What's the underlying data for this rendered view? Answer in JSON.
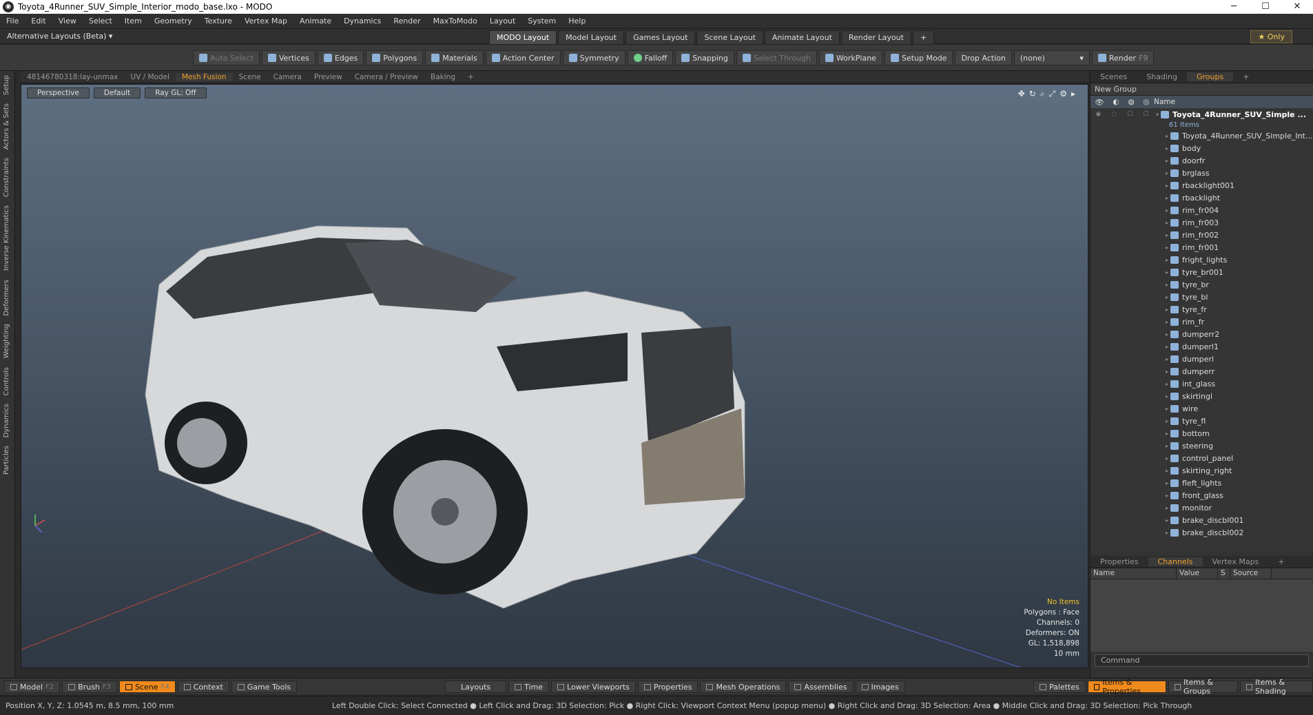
{
  "window": {
    "title": "Toyota_4Runner_SUV_Simple_Interior_modo_base.lxo - MODO",
    "minimize": "─",
    "maximize": "☐",
    "close": "✕"
  },
  "menu": [
    "File",
    "Edit",
    "View",
    "Select",
    "Item",
    "Geometry",
    "Texture",
    "Vertex Map",
    "Animate",
    "Dynamics",
    "Render",
    "MaxToModo",
    "Layout",
    "System",
    "Help"
  ],
  "layout": {
    "alt_layouts": "Alternative Layouts (Beta) ▾",
    "tabs": [
      "MODO Layout",
      "Model Layout",
      "Games Layout",
      "Scene Layout",
      "Animate Layout",
      "Render Layout"
    ],
    "add": "+",
    "only": "★ Only"
  },
  "toolbar": {
    "auto_select": "Auto Select",
    "vertices": "Vertices",
    "edges": "Edges",
    "polygons": "Polygons",
    "materials": "Materials",
    "action_center": "Action Center",
    "symmetry": "Symmetry",
    "falloff": "Falloff",
    "snapping": "Snapping",
    "select_through": "Select Through",
    "workplane": "WorkPlane",
    "setup_mode": "Setup Mode",
    "drop_action": "Drop Action",
    "drop_value": "(none)",
    "render": "Render",
    "render_key": "F9"
  },
  "left_tabs": [
    "Setup",
    "Actors & Sets",
    "Constraints",
    "Inverse Kinematics",
    "Deformers",
    "Weighting",
    "Controls",
    "Dynamics",
    "Particles"
  ],
  "viewport_tabs": [
    "48146780318:lay-unmax",
    "UV / Model",
    "Mesh Fusion",
    "Scene",
    "Camera",
    "Preview",
    "Camera / Preview",
    "Baking",
    "+"
  ],
  "viewport": {
    "view": "Perspective",
    "shading": "Default",
    "raygl": "Ray GL: Off",
    "stats": {
      "no_items": "No Items",
      "polygons": "Polygons : Face",
      "channels": "Channels: 0",
      "deformers": "Deformers: ON",
      "gl": "GL: 1,518,898",
      "grid": "10 mm"
    }
  },
  "right_panel": {
    "tabs": [
      "Scenes",
      "Shading",
      "Groups",
      "+"
    ],
    "new_group": "New Group",
    "name_header": "Name",
    "root": "Toyota_4Runner_SUV_Simple ...",
    "root_count": "61 Items",
    "items": [
      "Toyota_4Runner_SUV_Simple_Int...",
      "body",
      "doorfr",
      "brglass",
      "rbacklight001",
      "rbacklight",
      "rim_fr004",
      "rim_fr003",
      "rim_fr002",
      "rim_fr001",
      "fright_lights",
      "tyre_br001",
      "tyre_br",
      "tyre_bl",
      "tyre_fr",
      "rim_fr",
      "dumperr2",
      "dumperl1",
      "dumperl",
      "dumperr",
      "int_glass",
      "skirtingl",
      "wire",
      "tyre_fl",
      "bottom",
      "steering",
      "control_panel",
      "skirting_right",
      "fleft_lights",
      "front_glass",
      "monitor",
      "brake_discbl001",
      "brake_discbl002"
    ],
    "channel_tabs": [
      "Properties",
      "Channels",
      "Vertex Maps",
      "+"
    ],
    "channel_cols": [
      "Name",
      "Value",
      "S",
      "Source"
    ],
    "command_placeholder": "Command"
  },
  "bottom": {
    "model": "Model",
    "model_key": "F2",
    "brush": "Brush",
    "brush_key": "F3",
    "scene": "Scene",
    "scene_key": "F4",
    "context": "Context",
    "game_tools": "Game Tools",
    "layouts": "Layouts",
    "time": "Time",
    "lower_viewports": "Lower Viewports",
    "properties": "Properties",
    "mesh_operations": "Mesh Operations",
    "assemblies": "Assemblies",
    "images": "Images",
    "palettes": "Palettes",
    "items_properties": "Items & Properties",
    "items_groups": "Items & Groups",
    "items_shading": "Items & Shading"
  },
  "status": {
    "position": "Position X, Y, Z:   1.0545 m, 8.5 mm, 100 mm",
    "hint": "Left Double Click: Select Connected ● Left Click and Drag: 3D Selection: Pick ● Right Click: Viewport Context Menu (popup menu) ● Right Click and Drag: 3D Selection: Area ● Middle Click and Drag: 3D Selection: Pick Through"
  }
}
